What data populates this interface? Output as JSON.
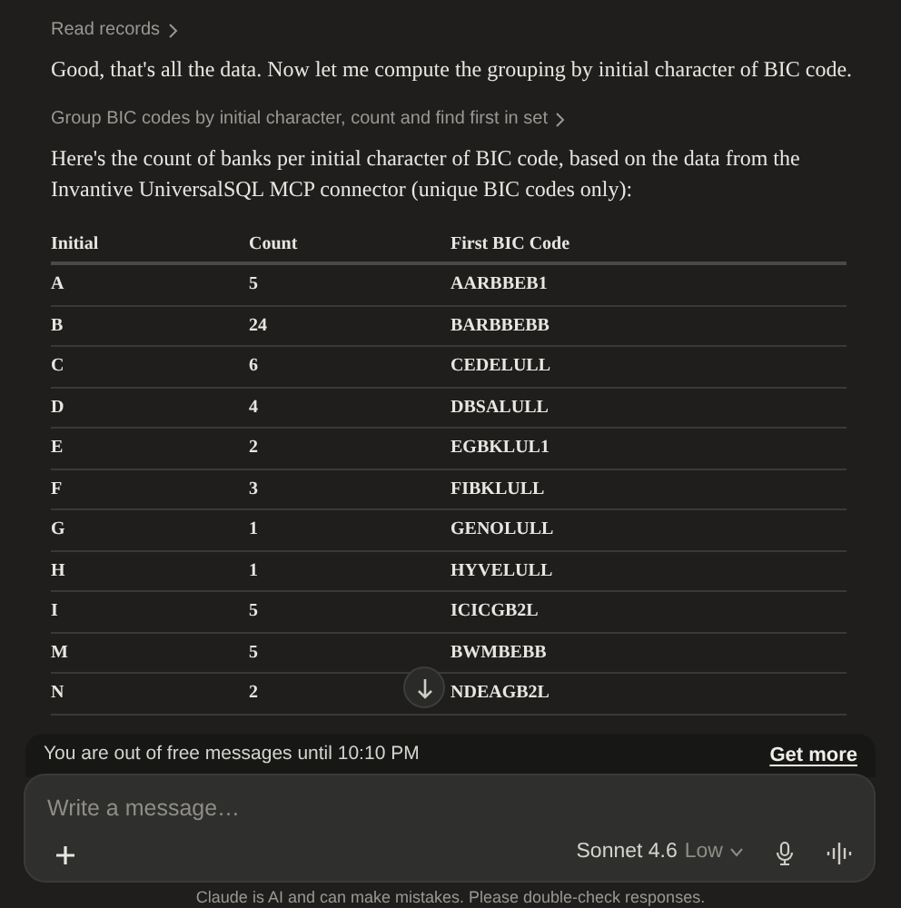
{
  "steps": [
    {
      "kind": "tool",
      "text": "Read records"
    },
    {
      "kind": "message",
      "text": "Good, that's all the data. Now let me compute the grouping by initial character of BIC code."
    },
    {
      "kind": "tool",
      "text": "Group BIC codes by initial character, count and find first in set"
    },
    {
      "kind": "message",
      "text": "Here's the count of banks per initial character of BIC code, based on the data from the Invantive UniversalSQL MCP connector (unique BIC codes only):"
    }
  ],
  "table": {
    "columns": [
      "Initial",
      "Count",
      "First BIC Code"
    ],
    "rows": [
      [
        "A",
        "5",
        "AARBBEB1"
      ],
      [
        "B",
        "24",
        "BARBBEBB"
      ],
      [
        "C",
        "6",
        "CEDELULL"
      ],
      [
        "D",
        "4",
        "DBSALULL"
      ],
      [
        "E",
        "2",
        "EGBKLUL1"
      ],
      [
        "F",
        "3",
        "FIBKLULL"
      ],
      [
        "G",
        "1",
        "GENOLULL"
      ],
      [
        "H",
        "1",
        "HYVELULL"
      ],
      [
        "I",
        "5",
        "ICICGB2L"
      ],
      [
        "M",
        "5",
        "BWMBEBB"
      ],
      [
        "N",
        "2",
        "NDEAGB2L"
      ]
    ]
  },
  "limit_banner": {
    "text": "You are out of free messages until 10:10 PM",
    "link": "Get more"
  },
  "composer": {
    "placeholder": "Write a message…",
    "model": "Sonnet 4.6",
    "effort": "Low"
  },
  "disclaimer": "Claude is AI and can make mistakes. Please double-check responses."
}
